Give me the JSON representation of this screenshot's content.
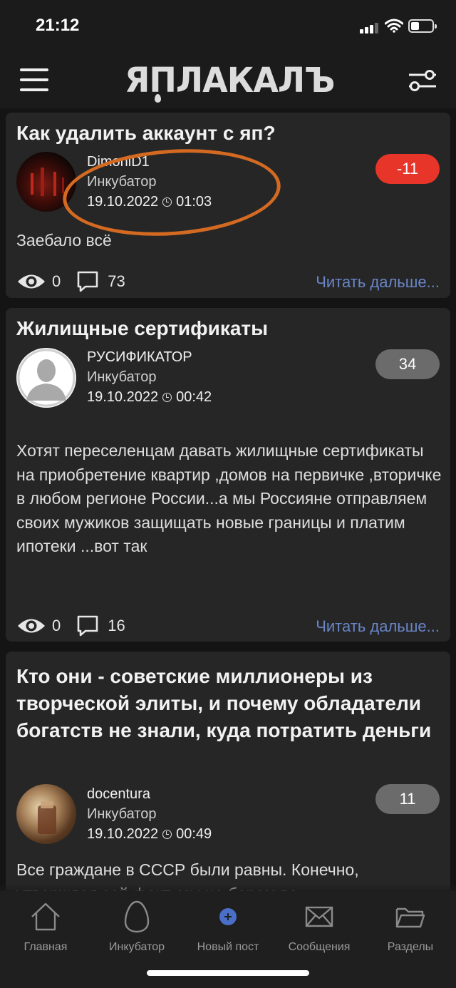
{
  "status": {
    "time": "21:12"
  },
  "header": {
    "logo": "ЯПЛАКАЛЪ"
  },
  "posts": [
    {
      "title": "Как удалить аккаунт с яп?",
      "author": "DimoniD1",
      "section": "Инкубатор",
      "date": "19.10.2022",
      "time": "01:03",
      "rating": "-11",
      "text": "Заебало всё",
      "views": "0",
      "comments": "73",
      "read_more": "Читать дальше..."
    },
    {
      "title": "Жилищные сертификаты",
      "author": "РУСИФИКАТОР",
      "section": "Инкубатор",
      "date": "19.10.2022",
      "time": "00:42",
      "rating": "34",
      "text": "Хотят переселенцам давать жилищные сертификаты на приобретение квартир ,домов на первичке ,вторичке в любом регионе России...а мы Россияне отправляем своих мужиков защищать новые границы и платим ипотеки ...вот так",
      "views": "0",
      "comments": "16",
      "read_more": "Читать дальше..."
    },
    {
      "title": "Кто они - советские миллионеры из творческой элиты, и почему обладатели богатств не знали, куда потратить деньги",
      "author": "docentura",
      "section": "Инкубатор",
      "date": "19.10.2022",
      "time": "00:49",
      "rating": "11",
      "text": "Все граждане в СССР были равны. Конечно, утверждая сей факт, мы не берем во"
    }
  ],
  "nav": [
    {
      "label": "Главная",
      "icon": "home-icon"
    },
    {
      "label": "Инкубатор",
      "icon": "egg-icon"
    },
    {
      "label": "Новый пост",
      "icon": "new-post-icon"
    },
    {
      "label": "Сообщения",
      "icon": "envelope-icon"
    },
    {
      "label": "Разделы",
      "icon": "folder-icon"
    }
  ],
  "colors": {
    "negative_rating": "#e8352a",
    "neutral_rating": "#6b6b6b",
    "link": "#6a86c8",
    "new_post_accent": "#4a6fc8",
    "annotation": "#d46a22"
  }
}
